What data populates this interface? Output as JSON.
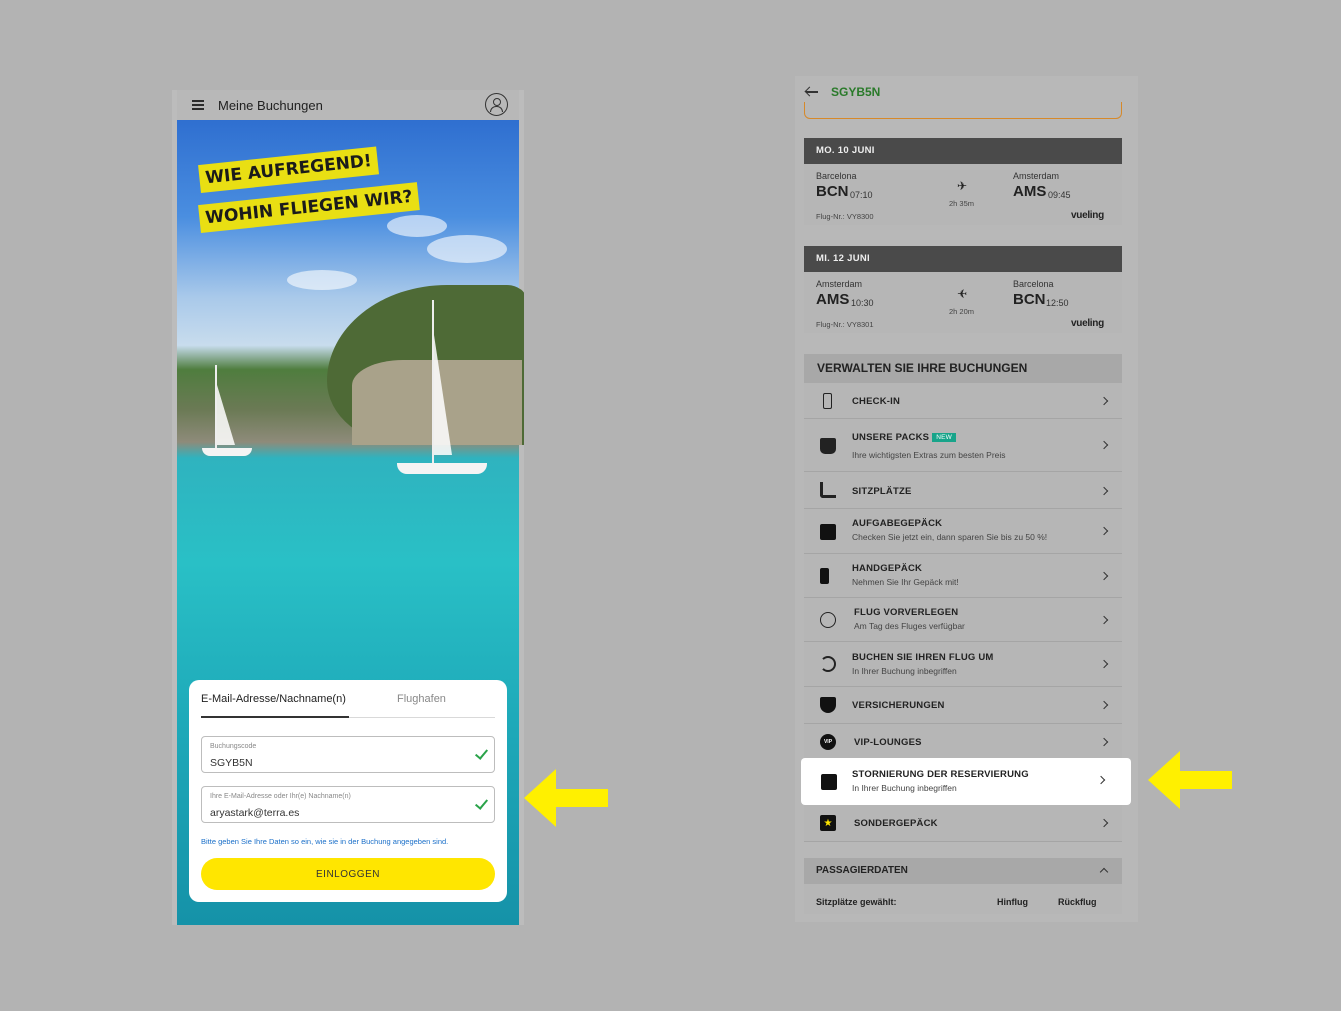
{
  "left_screen": {
    "header_title": "Meine Buchungen",
    "banner_line1": "WIE AUFREGEND!",
    "banner_line2": "WOHIN FLIEGEN WIR?",
    "tabs": [
      "E-Mail-Adresse/Nachname(n)",
      "Flughafen"
    ],
    "booking_code": {
      "label": "Buchungscode",
      "value": "SGYB5N"
    },
    "email": {
      "label": "Ihre E-Mail-Adresse oder Ihr(e) Nachname(n)",
      "value": "aryastark@terra.es"
    },
    "hint": "Bitte geben Sie Ihre Daten so ein, wie sie in der Buchung angegeben sind.",
    "login_button": "EINLOGGEN"
  },
  "right_screen": {
    "booking_code": "SGYB5N",
    "flights": [
      {
        "date": "MO. 10 JUNI",
        "from_city": "Barcelona",
        "from_code": "BCN",
        "from_time": "07:10",
        "duration": "2h 35m",
        "to_city": "Amsterdam",
        "to_code": "AMS",
        "to_time": "09:45",
        "flight_no": "Flug-Nr.: VY8300",
        "airline": "vueling"
      },
      {
        "date": "MI. 12 JUNI",
        "from_city": "Amsterdam",
        "from_code": "AMS",
        "from_time": "10:30",
        "duration": "2h 20m",
        "to_city": "Barcelona",
        "to_code": "BCN",
        "to_time": "12:50",
        "flight_no": "Flug-Nr.: VY8301",
        "airline": "vueling"
      }
    ],
    "manage_title": "VERWALTEN SIE IHRE BUCHUNGEN",
    "menu": [
      {
        "title": "CHECK-IN",
        "sub": "",
        "icon": "phone-icon"
      },
      {
        "title": "UNSERE PACKS",
        "badge": "NEW",
        "sub": "Ihre wichtigsten Extras zum besten Preis",
        "icon": "basket-icon"
      },
      {
        "title": "SITZPLÄTZE",
        "sub": "",
        "icon": "seat-icon"
      },
      {
        "title": "AUFGABEGEPÄCK",
        "sub": "Checken Sie jetzt ein, dann sparen Sie bis zu 50 %!",
        "icon": "suitcase-icon"
      },
      {
        "title": "HANDGEPÄCK",
        "sub": "Nehmen Sie Ihr Gepäck mit!",
        "icon": "hand-luggage-icon"
      },
      {
        "title": "FLUG VORVERLEGEN",
        "sub": "Am Tag des Fluges verfügbar",
        "icon": "clock-icon"
      },
      {
        "title": "BUCHEN SIE IHREN FLUG UM",
        "sub": "In Ihrer Buchung inbegriffen",
        "icon": "rebook-icon"
      },
      {
        "title": "VERSICHERUNGEN",
        "sub": "",
        "icon": "shield-icon"
      },
      {
        "title": "VIP-LOUNGES",
        "sub": "",
        "icon": "vip-icon"
      },
      {
        "title": "STORNIERUNG DER RESERVIERUNG",
        "sub": "In Ihrer Buchung inbegriffen",
        "icon": "cancel-booking-icon"
      },
      {
        "title": "SONDERGEPÄCK",
        "sub": "",
        "icon": "special-luggage-icon"
      }
    ],
    "passenger_title": "PASSAGIERDATEN",
    "seats_label": "Sitzplätze gewählt:",
    "col_outbound": "Hinflug",
    "col_return": "Rückflug",
    "vip_text": "VIP"
  },
  "colors": {
    "accent_yellow": "#ffe600",
    "check_green": "#2aa34a",
    "link_blue": "#1a6fc9",
    "badge_teal": "#18a48a"
  }
}
